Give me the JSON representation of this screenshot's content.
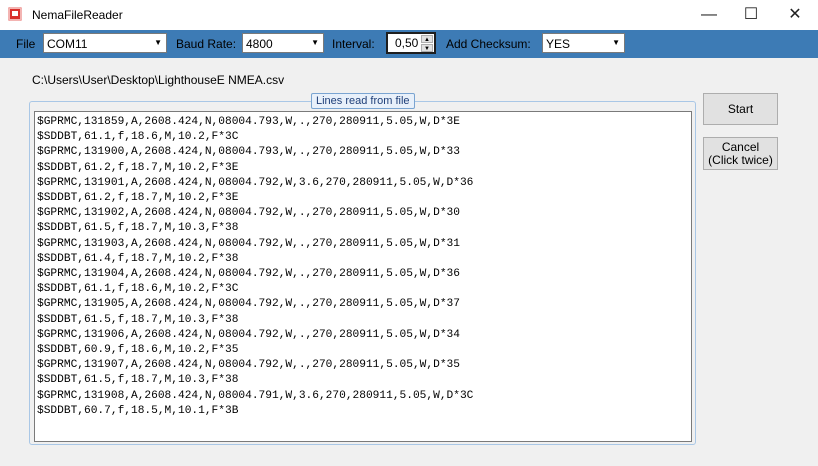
{
  "window": {
    "title": "NemaFileReader",
    "minimize_glyph": "—",
    "maximize_glyph": "☐",
    "close_glyph": "✕"
  },
  "toolbar": {
    "file_label": "File",
    "file_value": "COM11",
    "baud_label": "Baud Rate:",
    "baud_value": "4800",
    "interval_label": "Interval:",
    "interval_value": "0,50",
    "checksum_label": "Add Checksum:",
    "checksum_value": "YES",
    "dropdown_glyph": "▼",
    "spin_up_glyph": "▲",
    "spin_down_glyph": "▼"
  },
  "file_path": "C:\\Users\\User\\Desktop\\LighthouseE NMEA.csv",
  "group": {
    "title": "Lines read from file",
    "lines": [
      "$GPRMC,131859,A,2608.424,N,08004.793,W,.,270,280911,5.05,W,D*3E",
      "$SDDBT,61.1,f,18.6,M,10.2,F*3C",
      "$GPRMC,131900,A,2608.424,N,08004.793,W,.,270,280911,5.05,W,D*33",
      "$SDDBT,61.2,f,18.7,M,10.2,F*3E",
      "$GPRMC,131901,A,2608.424,N,08004.792,W,3.6,270,280911,5.05,W,D*36",
      "$SDDBT,61.2,f,18.7,M,10.2,F*3E",
      "$GPRMC,131902,A,2608.424,N,08004.792,W,.,270,280911,5.05,W,D*30",
      "$SDDBT,61.5,f,18.7,M,10.3,F*38",
      "$GPRMC,131903,A,2608.424,N,08004.792,W,.,270,280911,5.05,W,D*31",
      "$SDDBT,61.4,f,18.7,M,10.2,F*38",
      "$GPRMC,131904,A,2608.424,N,08004.792,W,.,270,280911,5.05,W,D*36",
      "$SDDBT,61.1,f,18.6,M,10.2,F*3C",
      "$GPRMC,131905,A,2608.424,N,08004.792,W,.,270,280911,5.05,W,D*37",
      "$SDDBT,61.5,f,18.7,M,10.3,F*38",
      "$GPRMC,131906,A,2608.424,N,08004.792,W,.,270,280911,5.05,W,D*34",
      "$SDDBT,60.9,f,18.6,M,10.2,F*35",
      "$GPRMC,131907,A,2608.424,N,08004.792,W,.,270,280911,5.05,W,D*35",
      "$SDDBT,61.5,f,18.7,M,10.3,F*38",
      "$GPRMC,131908,A,2608.424,N,08004.791,W,3.6,270,280911,5.05,W,D*3C",
      "$SDDBT,60.7,f,18.5,M,10.1,F*3B"
    ]
  },
  "buttons": {
    "start": "Start",
    "cancel_line1": "Cancel",
    "cancel_line2": "(Click twice)"
  },
  "colors": {
    "toolbar": "#3d7bb5",
    "group_title_border": "#7aa4d1"
  }
}
